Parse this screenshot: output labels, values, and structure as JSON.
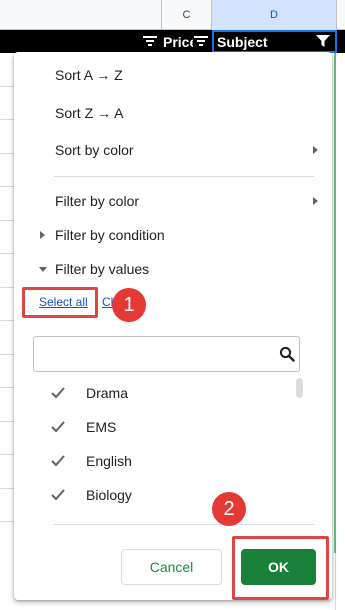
{
  "sheet": {
    "columns": [
      "C",
      "D"
    ],
    "header_cells": {
      "price": "Price",
      "subject": "Subject"
    }
  },
  "menu": {
    "sort_az": "Sort A → Z",
    "sort_za": "Sort Z → A",
    "sort_by_color": "Sort by color",
    "filter_by_color": "Filter by color",
    "filter_by_condition": "Filter by condition",
    "filter_by_values": "Filter by values",
    "select_all": "Select all",
    "clear": "Cl",
    "search": {
      "value": "",
      "placeholder": ""
    },
    "values": [
      {
        "label": "Drama",
        "checked": true
      },
      {
        "label": "EMS",
        "checked": true
      },
      {
        "label": "English",
        "checked": true
      },
      {
        "label": "Biology",
        "checked": true
      }
    ],
    "cancel": "Cancel",
    "ok": "OK"
  },
  "annotations": {
    "step1": "1",
    "step2": "2"
  },
  "colors": {
    "accent_green": "#188038",
    "annotation_red": "#e53935",
    "link_blue": "#1155cc"
  },
  "icons": [
    "filter-icon",
    "search-icon",
    "check-icon",
    "chevron-right-icon",
    "chevron-down-icon"
  ]
}
